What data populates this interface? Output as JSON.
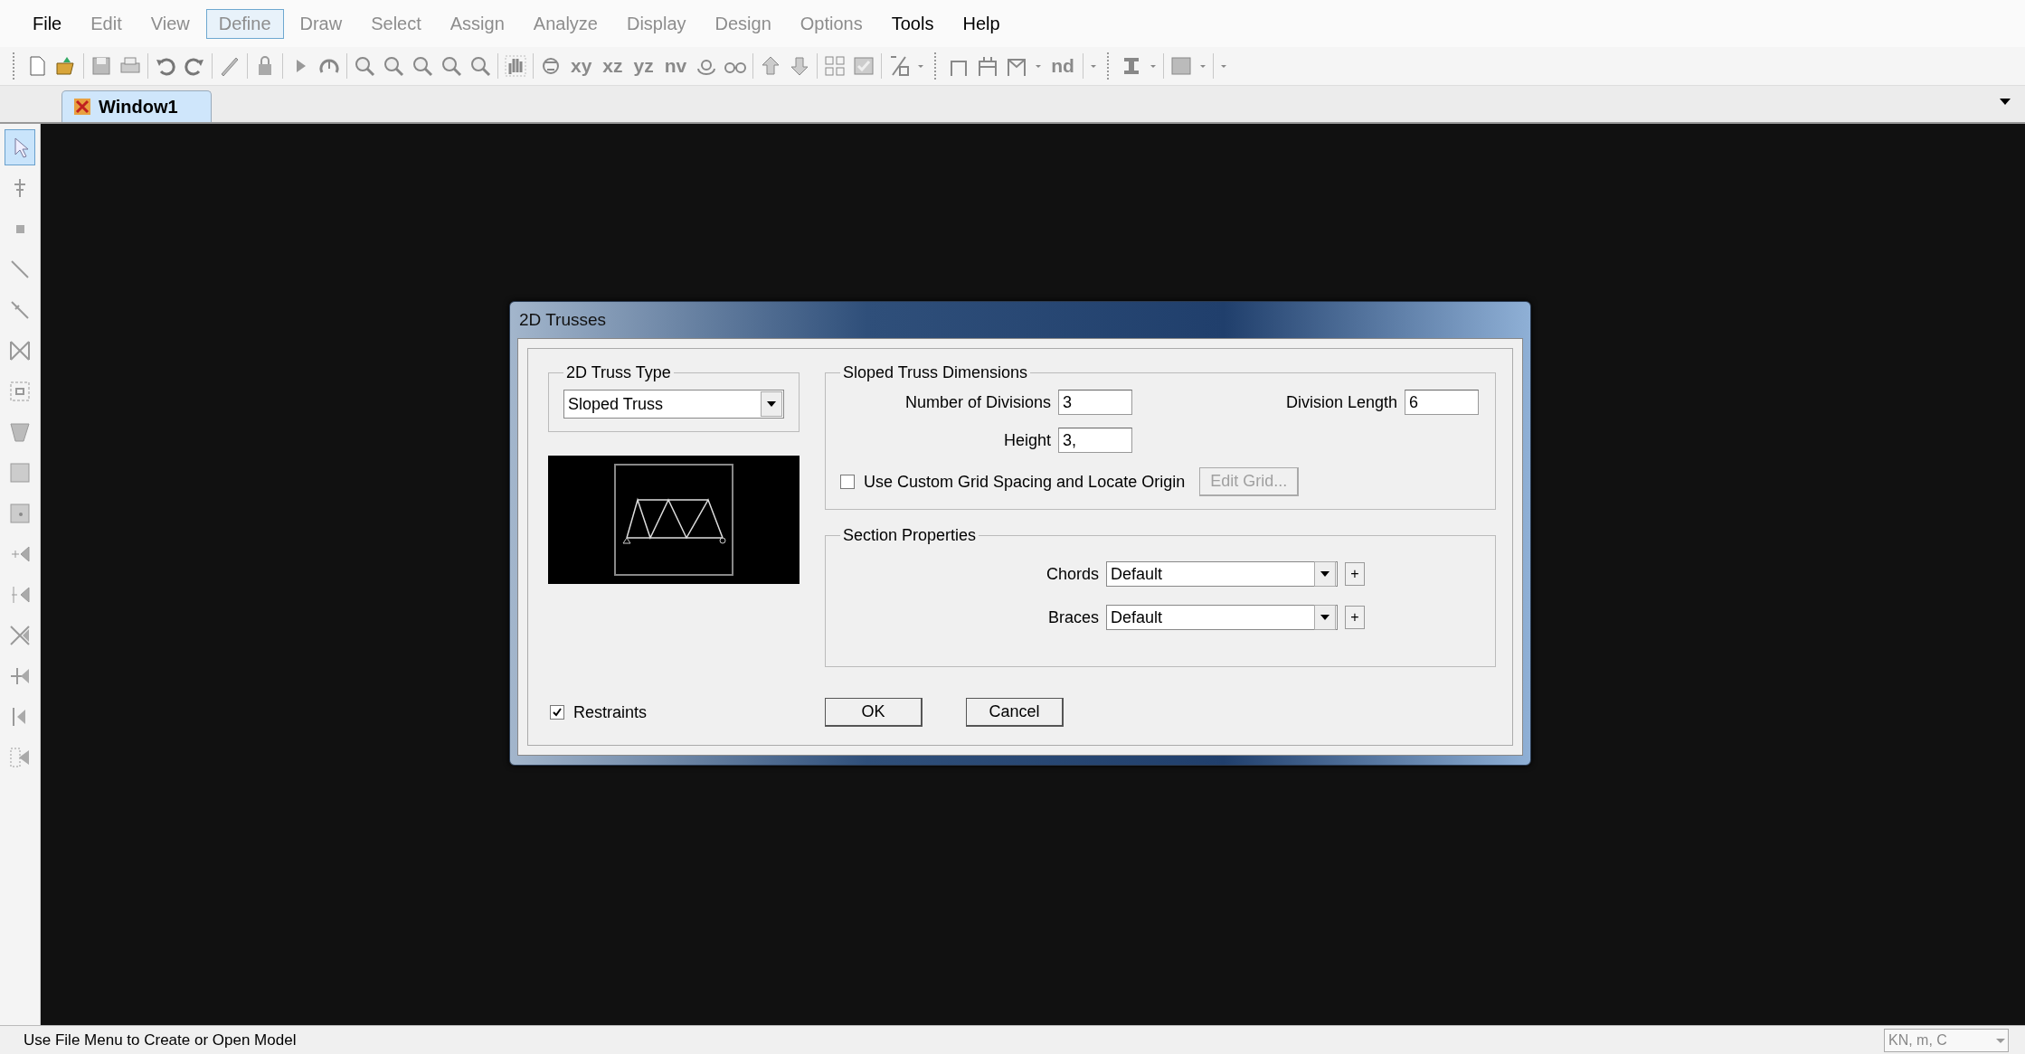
{
  "menu": [
    {
      "label": "File",
      "disabled": false,
      "selected": false
    },
    {
      "label": "Edit",
      "disabled": true,
      "selected": false
    },
    {
      "label": "View",
      "disabled": true,
      "selected": false
    },
    {
      "label": "Define",
      "disabled": true,
      "selected": true
    },
    {
      "label": "Draw",
      "disabled": true,
      "selected": false
    },
    {
      "label": "Select",
      "disabled": true,
      "selected": false
    },
    {
      "label": "Assign",
      "disabled": true,
      "selected": false
    },
    {
      "label": "Analyze",
      "disabled": true,
      "selected": false
    },
    {
      "label": "Display",
      "disabled": true,
      "selected": false
    },
    {
      "label": "Design",
      "disabled": true,
      "selected": false
    },
    {
      "label": "Options",
      "disabled": true,
      "selected": false
    },
    {
      "label": "Tools",
      "disabled": false,
      "selected": false
    },
    {
      "label": "Help",
      "disabled": false,
      "selected": false
    }
  ],
  "toolbar": {
    "text_buttons": [
      "xy",
      "xz",
      "yz",
      "nv",
      "nd"
    ]
  },
  "tab": {
    "label": "Window1",
    "selected": true
  },
  "tool_palette": [
    {
      "selected": true
    },
    {
      "selected": false
    },
    {
      "selected": false
    },
    {
      "selected": false
    },
    {
      "selected": false
    },
    {
      "selected": false
    },
    {
      "selected": false
    },
    {
      "selected": false
    },
    {
      "selected": false
    },
    {
      "selected": false
    },
    {
      "selected": false
    },
    {
      "selected": false
    },
    {
      "selected": false
    },
    {
      "selected": false
    },
    {
      "selected": false
    },
    {
      "selected": false
    }
  ],
  "dialog": {
    "title": "2D Trusses",
    "truss_type": {
      "legend": "2D Truss Type",
      "value": "Sloped Truss"
    },
    "dimensions": {
      "legend": "Sloped Truss Dimensions",
      "fields": [
        {
          "label": "Number of Divisions",
          "value": "3"
        },
        {
          "label": "Division Length",
          "value": "6"
        },
        {
          "label": "Height",
          "value": "3,"
        }
      ],
      "custom_grid": {
        "label": "Use Custom Grid Spacing and Locate Origin",
        "checked": false
      },
      "edit_grid_button": {
        "label": "Edit Grid...",
        "disabled": true
      }
    },
    "section_properties": {
      "legend": "Section Properties",
      "rows": [
        {
          "label": "Chords",
          "value": "Default",
          "add": "+"
        },
        {
          "label": "Braces",
          "value": "Default",
          "add": "+"
        }
      ]
    },
    "restraints": {
      "label": "Restraints",
      "checked": true
    },
    "buttons": [
      "OK",
      "Cancel"
    ]
  },
  "status_bar": {
    "message": "Use File Menu to Create or Open Model",
    "units": "KN, m, C"
  }
}
